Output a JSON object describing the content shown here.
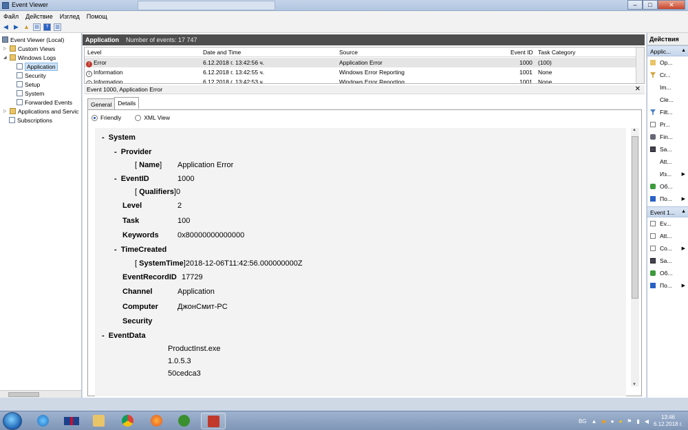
{
  "window": {
    "title": "Event Viewer"
  },
  "menu": [
    "Файл",
    "Действие",
    "Изглед",
    "Помощ"
  ],
  "tree": [
    {
      "label": "Event Viewer (Local)"
    },
    {
      "label": "Custom Views"
    },
    {
      "label": "Windows Logs"
    },
    {
      "label": "Application"
    },
    {
      "label": "Security"
    },
    {
      "label": "Setup"
    },
    {
      "label": "System"
    },
    {
      "label": "Forwarded Events"
    },
    {
      "label": "Applications and Servic"
    },
    {
      "label": "Subscriptions"
    }
  ],
  "log": {
    "title": "Application",
    "count": "Number of events: 17 747"
  },
  "grid": {
    "headers": [
      "Level",
      "Date and Time",
      "Source",
      "Event ID",
      "Task Category"
    ],
    "rows": [
      [
        "Error",
        "6.12.2018 г. 13:42:56 ч.",
        "Application Error",
        "1000",
        "(100)"
      ],
      [
        "Information",
        "6.12.2018 г. 13:42:55 ч.",
        "Windows Error Reporting",
        "1001",
        "None"
      ],
      [
        "Information",
        "6.12.2018 г. 13:42:53 ч.",
        "Windows Error Reporting",
        "1001",
        "None"
      ]
    ]
  },
  "detail": {
    "title": "Event 1000, Application Error",
    "tabs": [
      "General",
      "Details"
    ],
    "radio_friendly": "Friendly",
    "radio_xml": "XML View",
    "xml": {
      "system": "System",
      "provider": "Provider",
      "name_key": "Name",
      "name_val": "Application Error",
      "eventid_key": "EventID",
      "eventid_val": "1000",
      "qualifiers_key": "Qualifiers",
      "qualifiers_val": "0",
      "level_key": "Level",
      "level_val": "2",
      "task_key": "Task",
      "task_val": "100",
      "keywords_key": "Keywords",
      "keywords_val": "0x80000000000000",
      "timecreated_key": "TimeCreated",
      "systemtime_key": "SystemTime",
      "systemtime_val": "2018-12-06T11:42:56.000000000Z",
      "recordid_key": "EventRecordID",
      "recordid_val": "17729",
      "channel_key": "Channel",
      "channel_val": "Application",
      "computer_key": "Computer",
      "computer_val": "ДжонСмит-PC",
      "security_key": "Security",
      "eventdata": "EventData",
      "data1": "ProductInst.exe",
      "data2": "1.0.5.3",
      "data3": "50cedca3"
    }
  },
  "actions": {
    "header": "Действия",
    "section1": "Applic...",
    "items1": [
      "Op...",
      "Cr...",
      "Im...",
      "Cle...",
      "Filt...",
      "Pr...",
      "Fin...",
      "Sa...",
      "Att...",
      "Из...",
      "Об...",
      "По..."
    ],
    "section2": "Event 1...",
    "items2": [
      "Ev...",
      "Att...",
      "Co...",
      "Sa...",
      "Об...",
      "По..."
    ]
  },
  "taskbar": {
    "lang": "BG",
    "time": "13:46",
    "date": "6.12.2018 г."
  }
}
